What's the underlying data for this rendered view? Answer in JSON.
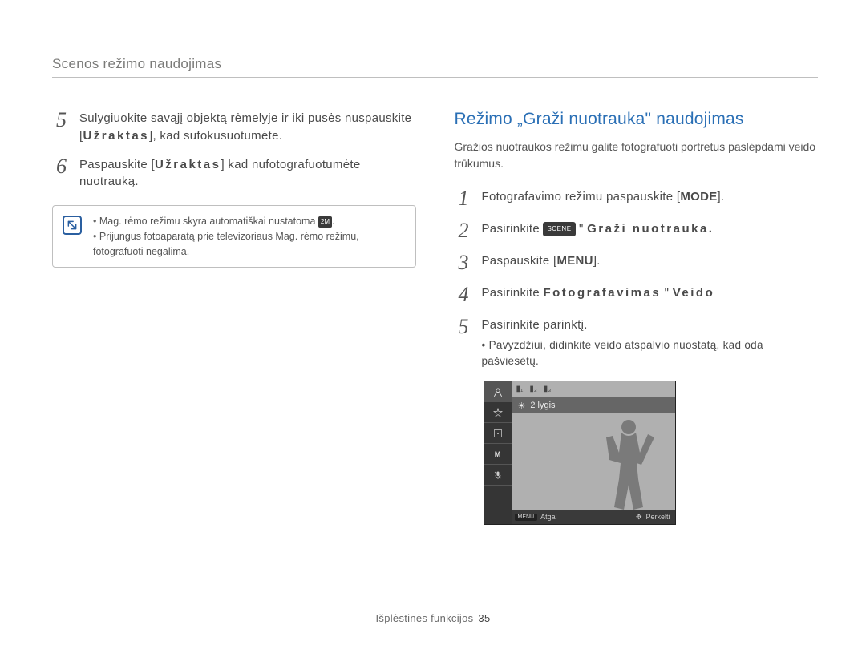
{
  "header": "Scenos režimo naudojimas",
  "left": {
    "step5": {
      "num": "5",
      "text_a": "Sulygiuokite savąjį objektą rėmelyje ir iki pusės nuspauskite [",
      "bold_key1": "Užraktas",
      "text_b": "], kad sufokusuotumėte."
    },
    "step6": {
      "num": "6",
      "text_a": "Paspauskite [",
      "bold_key1": "Užraktas",
      "text_b": "] kad nufotografuotumėte nuotrauką."
    },
    "note": {
      "li1_a": "Mag. rėmo režimu skyra automatiškai nustatoma ",
      "li1_badge": "2M",
      "li1_b": ".",
      "li2": "Prijungus fotoaparatą prie televizoriaus Mag. rėmo režimu, fotografuoti negalima."
    }
  },
  "right": {
    "title": "Režimo „Graži nuotrauka\" naudojimas",
    "intro": "Gražios nuotraukos režimu galite fotografuoti portretus paslėpdami veido trūkumus.",
    "step1": {
      "num": "1",
      "text_a": "Fotografavimo režimu paspauskite [",
      "bold": "MODE",
      "text_b": "]."
    },
    "step2": {
      "num": "2",
      "text_a": "Pasirinkite ",
      "badge": "SCENE",
      "text_b": " \"   ",
      "glitch": "Graži nuotrauka.",
      "text_c": ""
    },
    "step3": {
      "num": "3",
      "text_a": "Paspauskite [",
      "bold": "MENU",
      "text_b": "]."
    },
    "step4": {
      "num": "4",
      "text_a": "Pasirinkite ",
      "glitch_a": "Fotografavimas",
      "text_b": " \"   ",
      "glitch_b": "Veido"
    },
    "step5": {
      "num": "5",
      "text": "Pasirinkite parinktį.",
      "bullet": "Pavyzdžiui, didinkite veido atspalvio nuostatą, kad oda pašviesėtų."
    },
    "screen": {
      "level": "2 lygis",
      "footer_menu_label": "MENU",
      "footer_back": "Atgal",
      "footer_move": "Perkelti"
    }
  },
  "footer": {
    "text": "Išplėstinės funkcijos",
    "page": "35"
  }
}
